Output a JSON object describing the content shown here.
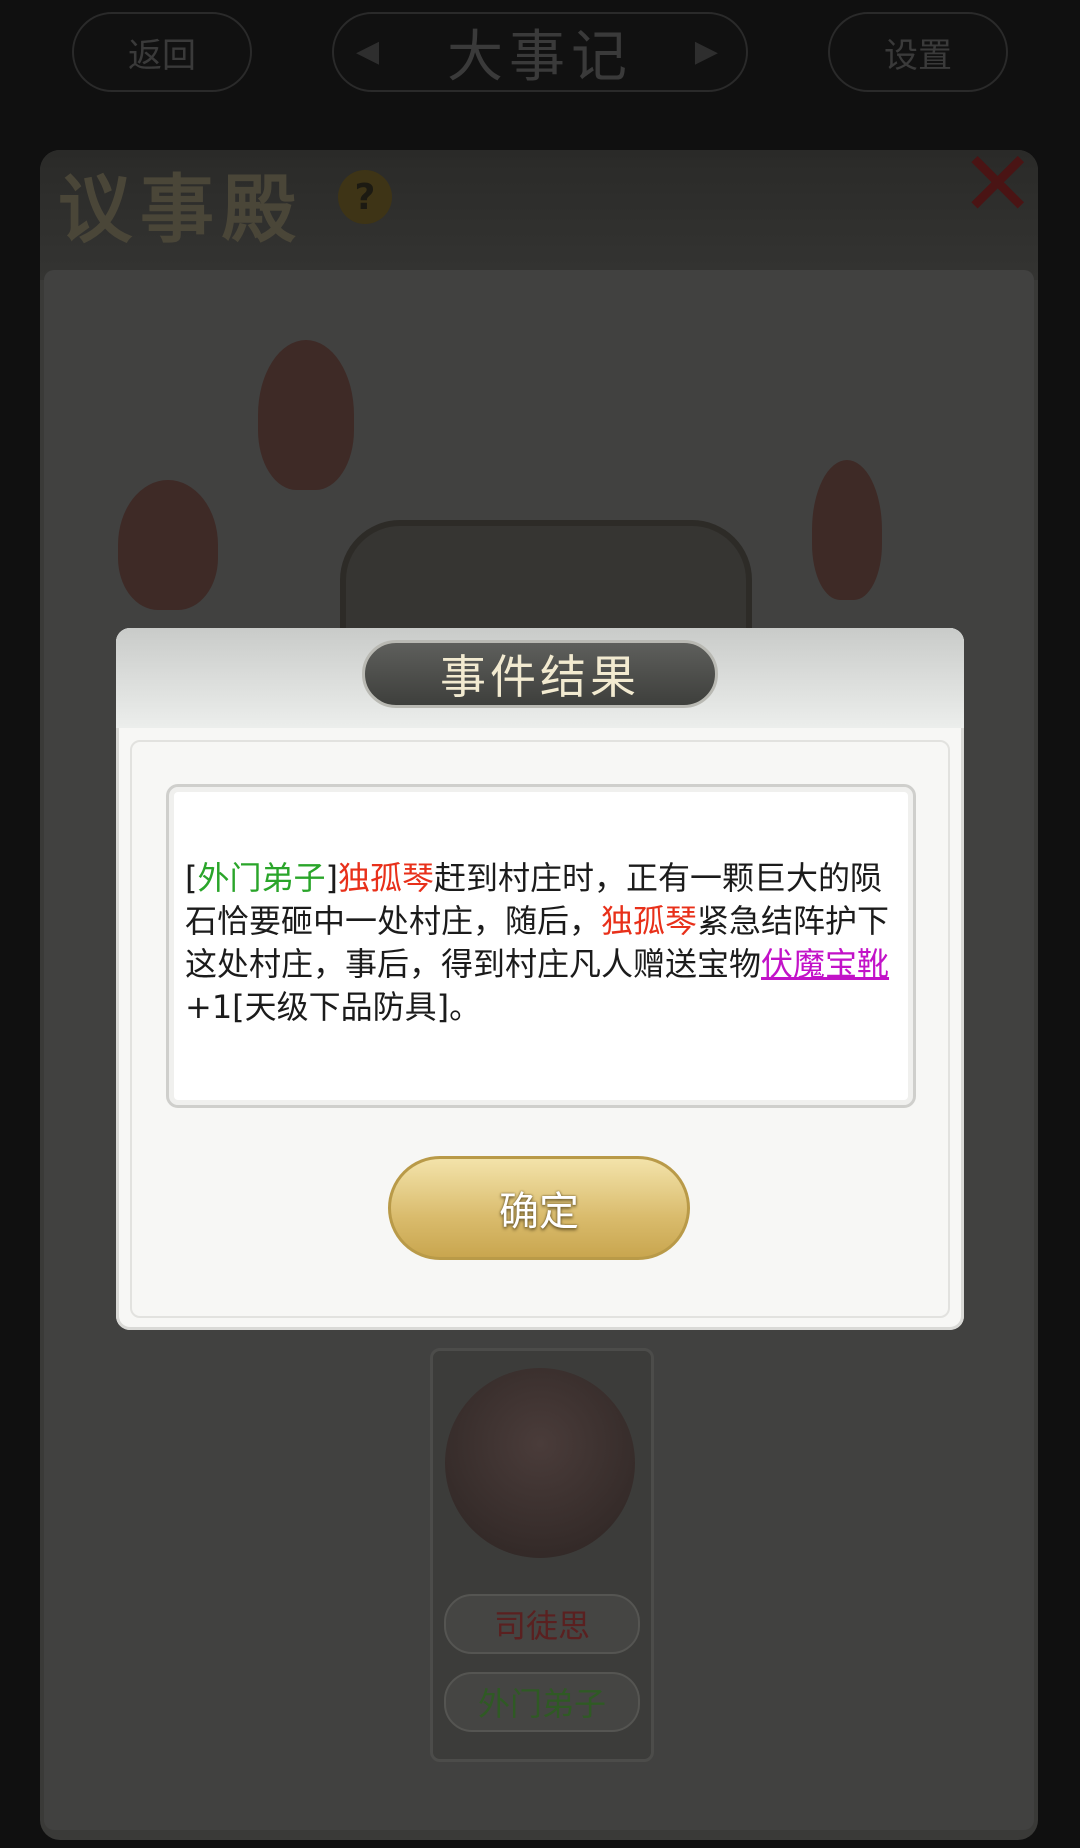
{
  "top_bar": {
    "left_label": "返回",
    "center_title": "大事记",
    "right_label": "设置"
  },
  "hall": {
    "title": "议事殿",
    "help_glyph": "?",
    "close_glyph": "✕"
  },
  "dialog": {
    "title": "事件结果",
    "result_segments": [
      {
        "text": "[",
        "style": "plain"
      },
      {
        "text": "外门弟子",
        "style": "green"
      },
      {
        "text": "]",
        "style": "plain"
      },
      {
        "text": "独孤琴",
        "style": "red"
      },
      {
        "text": "赶到村庄时，正有一颗巨大的陨石恰要砸中一处村庄，随后，",
        "style": "plain"
      },
      {
        "text": "独孤琴",
        "style": "red"
      },
      {
        "text": "紧急结阵护下这处村庄，事后，得到村庄凡人赠送宝物",
        "style": "plain"
      },
      {
        "text": "伏魔宝靴",
        "style": "magenta"
      },
      {
        "text": "+1[天级下品防具]。",
        "style": "plain"
      }
    ],
    "confirm_label": "确定"
  },
  "card": {
    "name": "司徒思",
    "rank": "外门弟子"
  },
  "colors": {
    "green": "#2aa52a",
    "red": "#e8301a",
    "magenta": "#c212c8",
    "gold": "#d9bb6c"
  }
}
